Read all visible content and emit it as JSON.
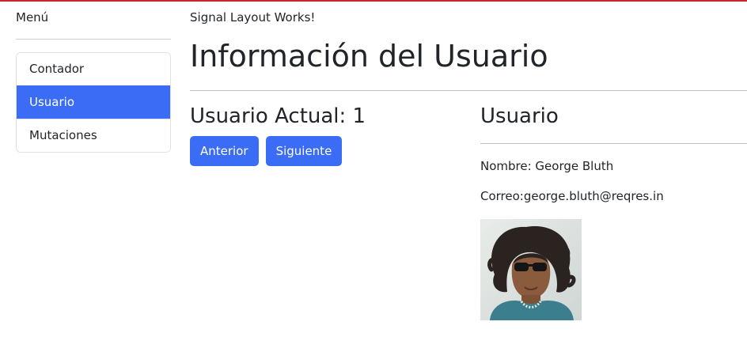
{
  "colors": {
    "accent": "#3b6cf6",
    "top_bar": "#c62828"
  },
  "sidebar": {
    "title": "Menú",
    "items": [
      {
        "label": "Contador",
        "active": false
      },
      {
        "label": "Usuario",
        "active": true
      },
      {
        "label": "Mutaciones",
        "active": false
      }
    ]
  },
  "main": {
    "layout_note": "Signal Layout Works!",
    "page_title": "Información del Usuario",
    "current_user_label": "Usuario Actual: 1",
    "buttons": {
      "prev": "Anterior",
      "next": "Siguiente"
    },
    "user_card": {
      "heading": "Usuario",
      "name_line": "Nombre: George Bluth",
      "email_line": "Correo:george.bluth@reqres.in",
      "avatar_icon": "user-photo"
    }
  }
}
